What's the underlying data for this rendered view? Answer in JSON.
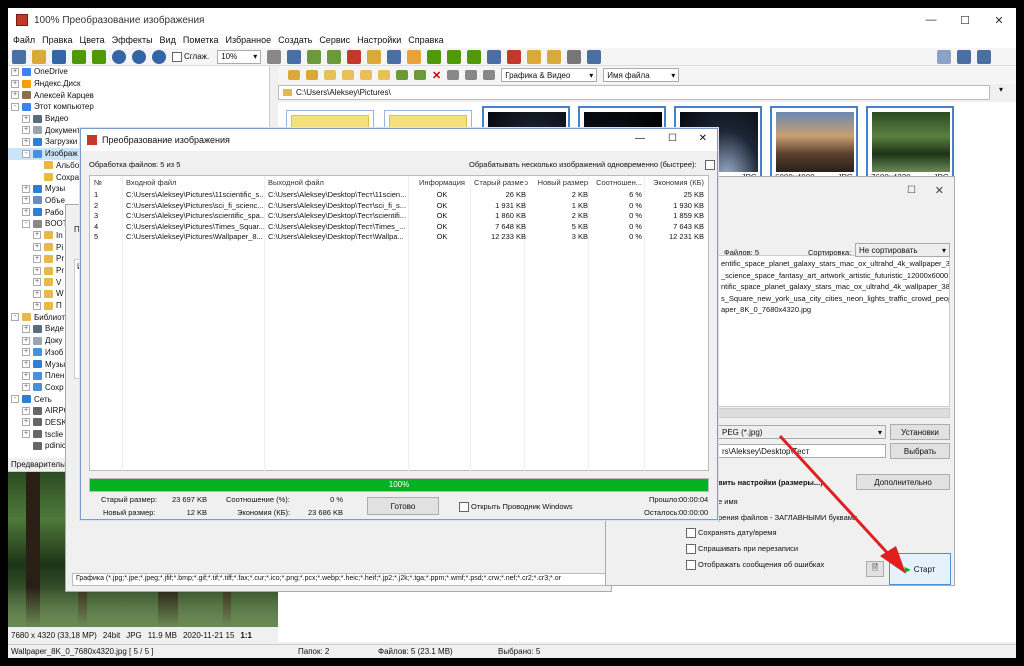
{
  "app": {
    "title": "100% Преобразование изображения",
    "window_controls": [
      "—",
      "☐",
      "✕"
    ]
  },
  "menu": [
    "Файл",
    "Правка",
    "Цвета",
    "Эффекты",
    "Вид",
    "Пометка",
    "Избранное",
    "Создать",
    "Сервис",
    "Настройки",
    "Справка"
  ],
  "toolbar": {
    "smooth_label": "Сглаж.",
    "zoom_value": "10%"
  },
  "nav": {
    "filter_value": "Графика & Видео",
    "sort_value": "Имя файла",
    "path": "C:\\Users\\Aleksey\\Pictures\\"
  },
  "tree": [
    {
      "label": "OneDrive",
      "indent": 0,
      "exp": "+",
      "color": "#3b82f6"
    },
    {
      "label": "Яндекс.Диск",
      "indent": 0,
      "exp": "+",
      "color": "#f59e0b"
    },
    {
      "label": "Алексей Карцев",
      "indent": 0,
      "exp": "+",
      "color": "#8b6f47"
    },
    {
      "label": "Этот компьютер",
      "indent": 0,
      "exp": "-",
      "color": "#3b82f6"
    },
    {
      "label": "Видео",
      "indent": 1,
      "exp": "+",
      "color": "#5a6b7b"
    },
    {
      "label": "Документы",
      "indent": 1,
      "exp": "+",
      "color": "#9aa5b1"
    },
    {
      "label": "Загрузки",
      "indent": 1,
      "exp": "+",
      "color": "#2d7fd3"
    },
    {
      "label": "Изображ",
      "indent": 1,
      "exp": "-",
      "color": "#4a90d9",
      "selected": true
    },
    {
      "label": "Альбо",
      "indent": 2,
      "exp": "",
      "color": "#e8b84a"
    },
    {
      "label": "Сохра",
      "indent": 2,
      "exp": "",
      "color": "#e8b84a"
    },
    {
      "label": "Музы",
      "indent": 1,
      "exp": "+",
      "color": "#2d7fd3"
    },
    {
      "label": "Объе",
      "indent": 1,
      "exp": "+",
      "color": "#6a8dbd"
    },
    {
      "label": "Рабо",
      "indent": 1,
      "exp": "+",
      "color": "#2d7fd3"
    },
    {
      "label": "BOOT",
      "indent": 1,
      "exp": "-",
      "color": "#888"
    },
    {
      "label": "In",
      "indent": 2,
      "exp": "+",
      "color": "#e8b84a"
    },
    {
      "label": "Pi",
      "indent": 2,
      "exp": "+",
      "color": "#e8b84a"
    },
    {
      "label": "Pr",
      "indent": 2,
      "exp": "+",
      "color": "#e8b84a"
    },
    {
      "label": "Pr",
      "indent": 2,
      "exp": "+",
      "color": "#e8b84a"
    },
    {
      "label": "V",
      "indent": 2,
      "exp": "+",
      "color": "#e8b84a"
    },
    {
      "label": "W",
      "indent": 2,
      "exp": "+",
      "color": "#e8b84a"
    },
    {
      "label": "П",
      "indent": 2,
      "exp": "+",
      "color": "#e8b84a"
    },
    {
      "label": "Библиоте",
      "indent": 0,
      "exp": "-",
      "color": "#e8b84a"
    },
    {
      "label": "Виде",
      "indent": 1,
      "exp": "+",
      "color": "#5a6b7b"
    },
    {
      "label": "Доку",
      "indent": 1,
      "exp": "+",
      "color": "#9aa5b1"
    },
    {
      "label": "Изоб",
      "indent": 1,
      "exp": "+",
      "color": "#4a90d9"
    },
    {
      "label": "Музы",
      "indent": 1,
      "exp": "+",
      "color": "#2d7fd3"
    },
    {
      "label": "Плен",
      "indent": 1,
      "exp": "+",
      "color": "#4a90d9"
    },
    {
      "label": "Сохр",
      "indent": 1,
      "exp": "+",
      "color": "#4a90d9"
    },
    {
      "label": "Сеть",
      "indent": 0,
      "exp": "-",
      "color": "#2d7fd3"
    },
    {
      "label": "AIRPO",
      "indent": 1,
      "exp": "+",
      "color": "#666"
    },
    {
      "label": "DESK",
      "indent": 1,
      "exp": "+",
      "color": "#666"
    },
    {
      "label": "tsclie",
      "indent": 1,
      "exp": "+",
      "color": "#666"
    },
    {
      "label": "pdinici",
      "indent": 1,
      "exp": "",
      "color": "#666"
    }
  ],
  "preview": {
    "label": "Предварительн",
    "info": [
      "7680 x 4320 (33,18 MP)",
      "24bit",
      "JPG",
      "11.9 MB",
      "2020-11-21 15",
      "1:1"
    ]
  },
  "thumbs": [
    {
      "caption_left": "",
      "caption_right": "",
      "kind": "folder"
    },
    {
      "caption_left": "",
      "caption_right": "",
      "kind": "folder"
    },
    {
      "caption_left": "",
      "caption_right": "",
      "kind": "space1"
    },
    {
      "caption_left": "",
      "caption_right": "",
      "kind": "space2"
    },
    {
      "caption_left": "",
      "caption_right": "JPG",
      "kind": "space3"
    },
    {
      "caption_left": "6000x4000",
      "caption_right": "JPG",
      "kind": "city"
    },
    {
      "caption_left": "7680x4320",
      "caption_right": "JPG",
      "kind": "forest"
    }
  ],
  "status": {
    "file": "Wallpaper_8K_0_7680x4320.jpg  [ 5 / 5 ]",
    "folders": "Папок: 2",
    "files": "Файлов: 5 (23.1 MB)",
    "selected": "Выбрано: 5"
  },
  "bg_dialog": {
    "partial_label": "Па",
    "partial_label2": "Ис",
    "files_label": "Файлов: 5",
    "sort_label": "Сортировка:",
    "sort_value": "Не сортировать",
    "list": [
      "entific_space_planet_galaxy_stars_mac_ox_ultrahd_4k_wallpaper_3",
      "_science_space_fantasy_art_artwork_artistic_futuristic_12000x6000",
      "ntific_space_planet_galaxy_stars_mac_ox_ultrahd_4k_wallpaper_384",
      "s_Square_new_york_usa_city_cities_neon_lights_traffic_crowd_peop",
      "aper_8K_0_7680x4320.jpg"
    ],
    "format_value": "PEG (*.jpg)",
    "settings_btn": "Установки",
    "outpath": "rs\\Aleksey\\Desktop\\Тест",
    "browse_btn": "Выбрать",
    "advanced_text": "вить настройки (размеры...)",
    "advanced_btn": "Дополнительно",
    "name_text": "е имя",
    "ext_text": "рения файлов - ЗАГЛАВНЫМИ буквами",
    "keep_date": "Сохранять дату/время",
    "ask_overwrite": "Спрашивать при перезаписи",
    "show_errors": "Отображать сообщения об ошибках",
    "start_btn": "Старт",
    "filter_text": "Графика (*.jpg;*.jpe;*.jpeg;*.jfif;*.bmp;*.gif;*.tif;*.tiff;*.fax;*.cur;*.ico;*.png;*.pcx;*.webp;*.heic;*.heif;*.jp2;*.j2k;*.tga;*.ppm;*.wmf;*.psd;*.crw;*.nef;*.cr2;*.cr3;*.or"
  },
  "dialog": {
    "title": "Преобразование изображения",
    "processing": "Обработка файлов: 5 из 5",
    "parallel_label": "Обрабатывать несколько изображений одновременно (быстрее):",
    "columns": [
      "№",
      "Входной файл",
      "Выходной файл",
      "Информация",
      "Старый размер",
      "Новый размер",
      "Соотношен...",
      "Экономия (КБ)"
    ],
    "rows": [
      [
        "1",
        "C:\\Users\\Aleksey\\Pictures\\11scientific_s...",
        "C:\\Users\\Aleksey\\Desktop\\Тест\\11scien...",
        "OK",
        "26 KB",
        "2 KB",
        "6 %",
        "25 KB"
      ],
      [
        "2",
        "C:\\Users\\Aleksey\\Pictures\\sci_fi_scienc...",
        "C:\\Users\\Aleksey\\Desktop\\Тест\\sci_fi_s...",
        "OK",
        "1 931 KB",
        "1 KB",
        "0 %",
        "1 930 KB"
      ],
      [
        "3",
        "C:\\Users\\Aleksey\\Pictures\\scientific_spa...",
        "C:\\Users\\Aleksey\\Desktop\\Тест\\scientifi...",
        "OK",
        "1 860 KB",
        "2 KB",
        "0 %",
        "1 859 KB"
      ],
      [
        "4",
        "C:\\Users\\Aleksey\\Pictures\\Times_Squar...",
        "C:\\Users\\Aleksey\\Desktop\\Тест\\Times_...",
        "OK",
        "7 648 KB",
        "5 KB",
        "0 %",
        "7 643 KB"
      ],
      [
        "5",
        "C:\\Users\\Aleksey\\Pictures\\Wallpaper_8...",
        "C:\\Users\\Aleksey\\Desktop\\Тест\\Wallpa...",
        "OK",
        "12 233 KB",
        "3 KB",
        "0 %",
        "12 231 KB"
      ]
    ],
    "progress_pct": 1.0,
    "progress_text": "100%",
    "old_size_label": "Старый размер:",
    "old_size": "23 697 KB",
    "new_size_label": "Новый размер:",
    "new_size": "12 KB",
    "ratio_label": "Соотношение (%):",
    "ratio": "0 %",
    "savings_label": "Экономия (КБ):",
    "savings": "23 686 KB",
    "done_btn": "Готово",
    "open_explorer": "Открыть Проводник Windows",
    "elapsed_label": "Прошло:",
    "elapsed": "00:00:04",
    "remaining_label": "Осталось:",
    "remaining": "00:00:00"
  },
  "colors": {
    "accent": "#4a90d9",
    "progress": "#06b025",
    "arrow": "#e02020"
  }
}
